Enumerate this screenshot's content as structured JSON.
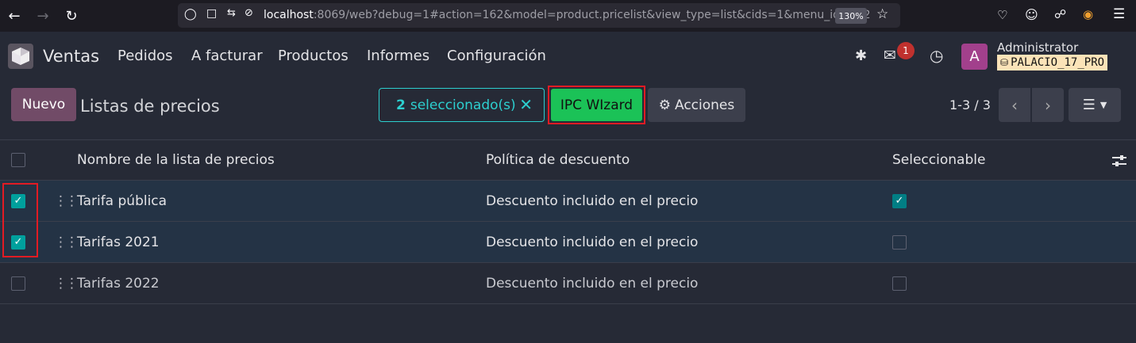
{
  "browser": {
    "url_host": "localhost",
    "url_rest": ":8069/web?debug=1#action=162&model=product.pricelist&view_type=list&cids=1&menu_id=212",
    "zoom": "130%"
  },
  "nav": {
    "app_name": "Ventas",
    "menus": [
      "Pedidos",
      "A facturar",
      "Productos",
      "Informes",
      "Configuración"
    ],
    "message_count": "1",
    "avatar_letter": "A",
    "user_name": "Administrator",
    "db_name": "PALACIO_17_PRO"
  },
  "control": {
    "new_label": "Nuevo",
    "title": "Listas de precios",
    "selected_count": "2",
    "selected_label": "seleccionado(s)",
    "ipc_label": "IPC WIzard",
    "actions_label": "Acciones",
    "pager": "1-3 / 3"
  },
  "table": {
    "headers": {
      "name": "Nombre de la lista de precios",
      "policy": "Política de descuento",
      "selectable": "Seleccionable"
    },
    "rows": [
      {
        "name": "Tarifa pública",
        "policy": "Descuento incluido en el precio"
      },
      {
        "name": "Tarifas 2021",
        "policy": "Descuento incluido en el precio"
      },
      {
        "name": "Tarifas 2022",
        "policy": "Descuento incluido en el precio"
      }
    ]
  },
  "icons": {
    "colors": {
      "accent": "#714b67",
      "teal": "#00a09d",
      "green": "#1bc257",
      "red_frame": "#e21b23"
    }
  }
}
